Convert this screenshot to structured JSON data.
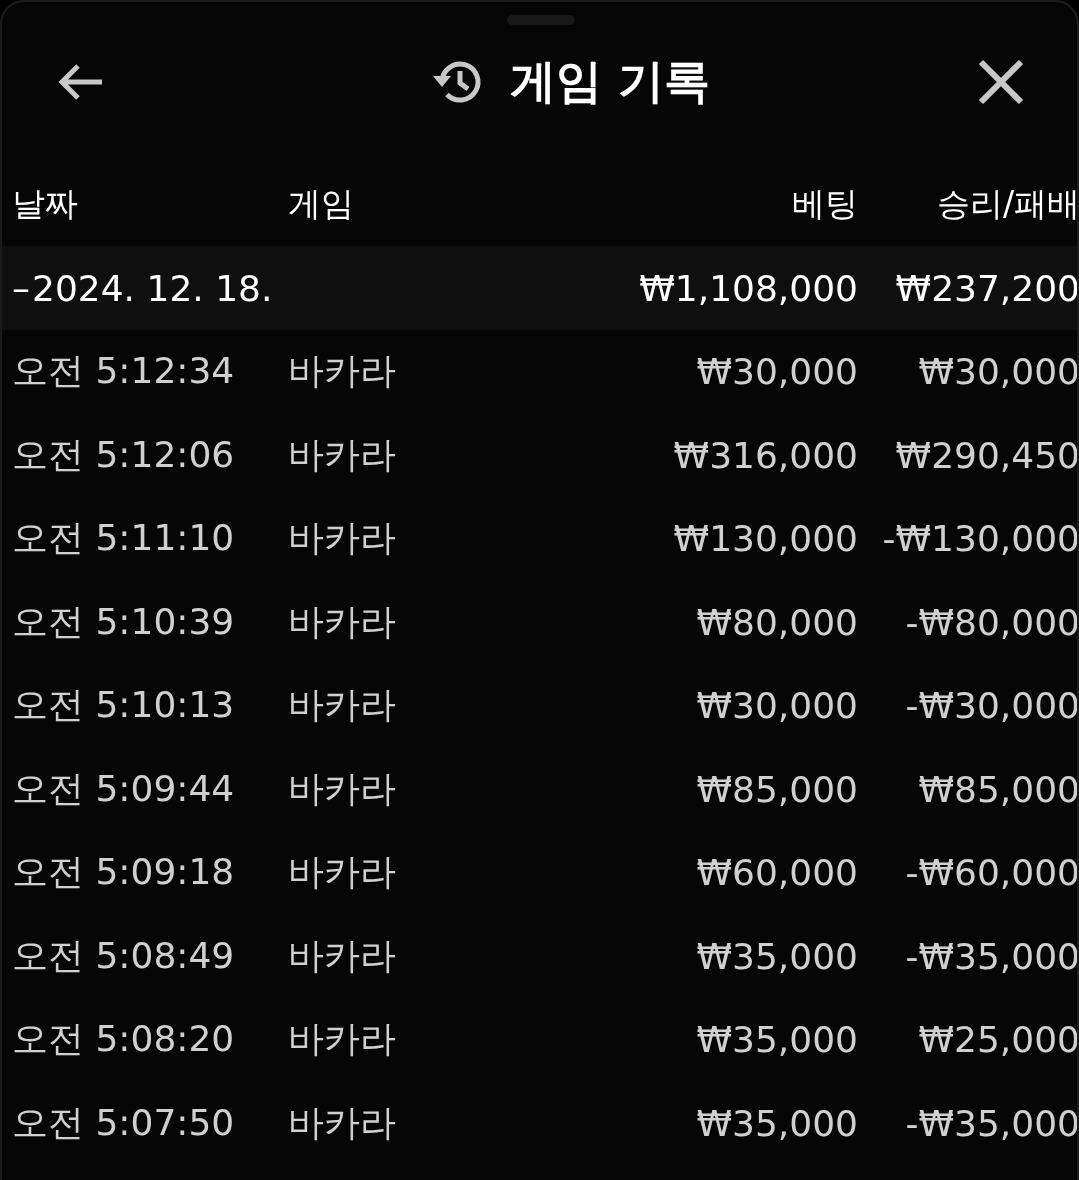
{
  "header": {
    "title": "게임 기록"
  },
  "table": {
    "columns": [
      "날짜",
      "게임",
      "베팅",
      "승리/패배"
    ],
    "groups": [
      {
        "toggle": "–",
        "date": "2024. 12. 18.",
        "bet": "₩1,108,000",
        "result": "₩237,200",
        "expanded": true,
        "rows": [
          {
            "time": "오전 5:12:34",
            "game": "바카라",
            "bet": "₩30,000",
            "result": "₩30,000"
          },
          {
            "time": "오전 5:12:06",
            "game": "바카라",
            "bet": "₩316,000",
            "result": "₩290,450"
          },
          {
            "time": "오전 5:11:10",
            "game": "바카라",
            "bet": "₩130,000",
            "result": "-₩130,000"
          },
          {
            "time": "오전 5:10:39",
            "game": "바카라",
            "bet": "₩80,000",
            "result": "-₩80,000"
          },
          {
            "time": "오전 5:10:13",
            "game": "바카라",
            "bet": "₩30,000",
            "result": "-₩30,000"
          },
          {
            "time": "오전 5:09:44",
            "game": "바카라",
            "bet": "₩85,000",
            "result": "₩85,000"
          },
          {
            "time": "오전 5:09:18",
            "game": "바카라",
            "bet": "₩60,000",
            "result": "-₩60,000"
          },
          {
            "time": "오전 5:08:49",
            "game": "바카라",
            "bet": "₩35,000",
            "result": "-₩35,000"
          },
          {
            "time": "오전 5:08:20",
            "game": "바카라",
            "bet": "₩35,000",
            "result": "₩25,000"
          },
          {
            "time": "오전 5:07:50",
            "game": "바카라",
            "bet": "₩35,000",
            "result": "-₩35,000"
          }
        ]
      }
    ]
  }
}
